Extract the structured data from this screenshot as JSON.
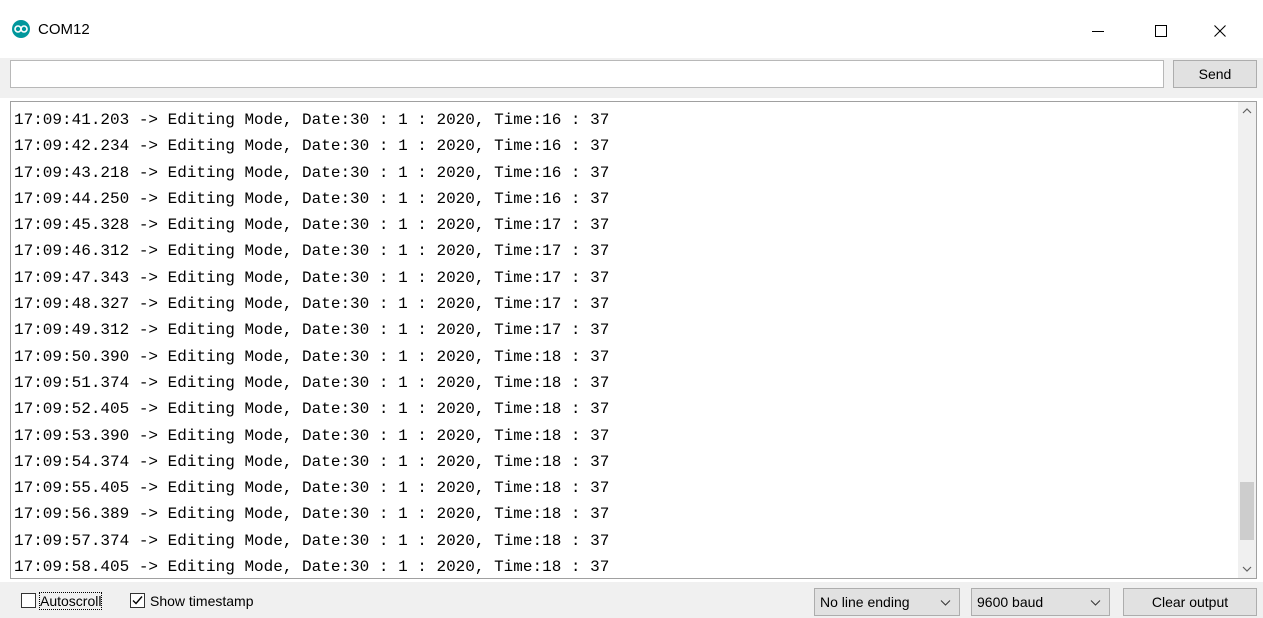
{
  "window": {
    "title": "COM12",
    "icon": "arduino-infinity-icon",
    "controls": [
      "minimize-icon",
      "maximize-icon",
      "close-icon"
    ]
  },
  "input": {
    "value": "",
    "placeholder": "",
    "send_label": "Send"
  },
  "output": {
    "lines": [
      "17:09:41.203 -> Editing Mode, Date:30 : 1 : 2020, Time:16 : 37",
      "17:09:42.234 -> Editing Mode, Date:30 : 1 : 2020, Time:16 : 37",
      "17:09:43.218 -> Editing Mode, Date:30 : 1 : 2020, Time:16 : 37",
      "17:09:44.250 -> Editing Mode, Date:30 : 1 : 2020, Time:16 : 37",
      "17:09:45.328 -> Editing Mode, Date:30 : 1 : 2020, Time:17 : 37",
      "17:09:46.312 -> Editing Mode, Date:30 : 1 : 2020, Time:17 : 37",
      "17:09:47.343 -> Editing Mode, Date:30 : 1 : 2020, Time:17 : 37",
      "17:09:48.327 -> Editing Mode, Date:30 : 1 : 2020, Time:17 : 37",
      "17:09:49.312 -> Editing Mode, Date:30 : 1 : 2020, Time:17 : 37",
      "17:09:50.390 -> Editing Mode, Date:30 : 1 : 2020, Time:18 : 37",
      "17:09:51.374 -> Editing Mode, Date:30 : 1 : 2020, Time:18 : 37",
      "17:09:52.405 -> Editing Mode, Date:30 : 1 : 2020, Time:18 : 37",
      "17:09:53.390 -> Editing Mode, Date:30 : 1 : 2020, Time:18 : 37",
      "17:09:54.374 -> Editing Mode, Date:30 : 1 : 2020, Time:18 : 37",
      "17:09:55.405 -> Editing Mode, Date:30 : 1 : 2020, Time:18 : 37",
      "17:09:56.389 -> Editing Mode, Date:30 : 1 : 2020, Time:18 : 37",
      "17:09:57.374 -> Editing Mode, Date:30 : 1 : 2020, Time:18 : 37",
      "17:09:58.405 -> Editing Mode, Date:30 : 1 : 2020, Time:18 : 37"
    ]
  },
  "statusbar": {
    "autoscroll": {
      "label": "Autoscroll",
      "checked": false
    },
    "show_timestamp": {
      "label": "Show timestamp",
      "checked": true
    },
    "line_ending": "No line ending",
    "baud_rate": "9600 baud",
    "clear_label": "Clear output"
  },
  "colors": {
    "arduino_teal": "#00979c",
    "chrome_gray": "#f0f0f0",
    "button_gray": "#e1e1e1"
  }
}
